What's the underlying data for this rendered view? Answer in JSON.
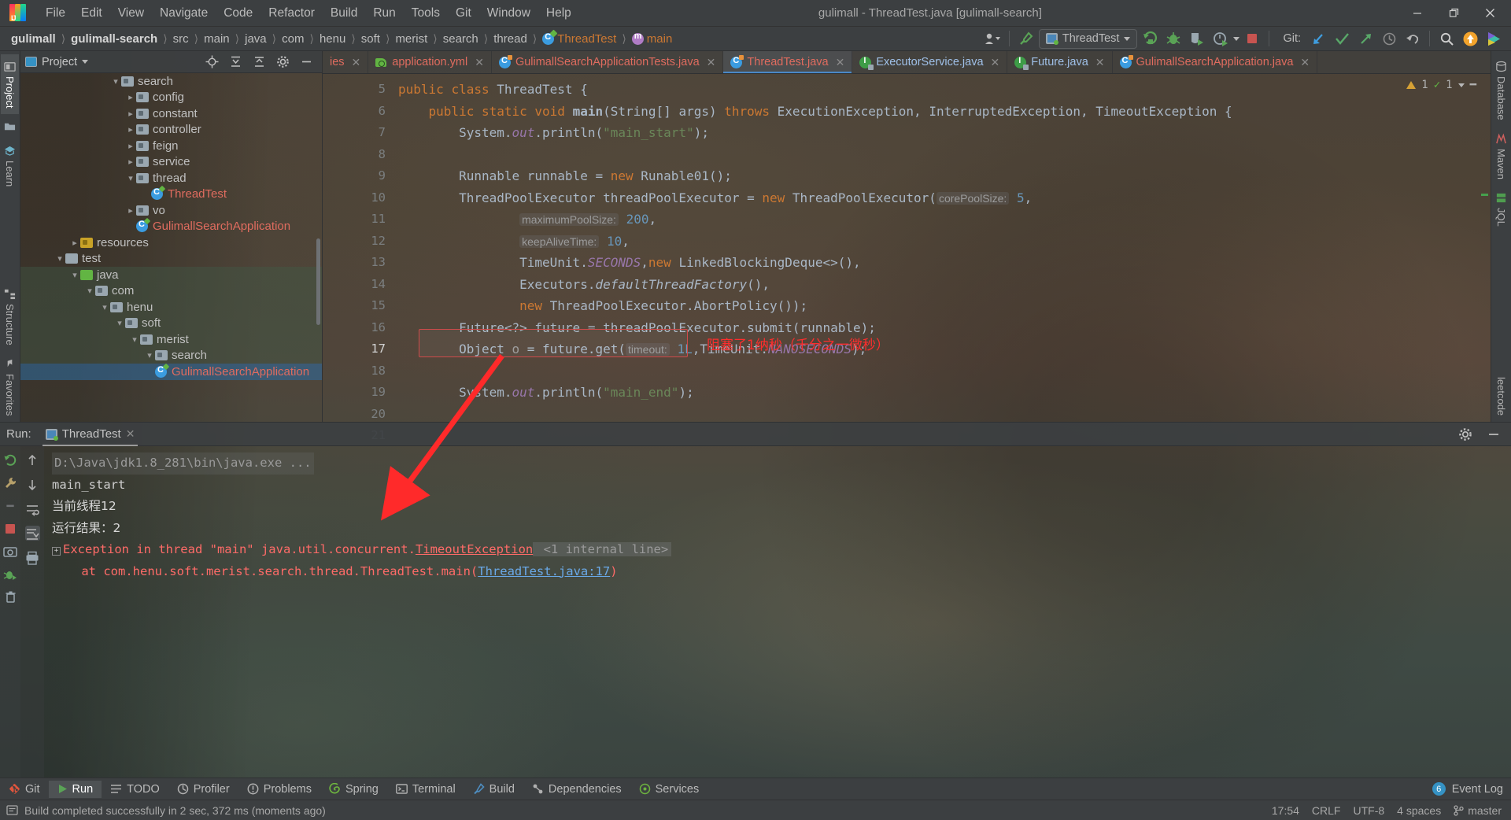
{
  "window": {
    "title": "gulimall - ThreadTest.java [gulimall-search]",
    "app_icon": "intellij-idea-logo",
    "minimize": "–",
    "maximize": "❐",
    "close": "✕"
  },
  "menu": [
    {
      "label": "File"
    },
    {
      "label": "Edit"
    },
    {
      "label": "View"
    },
    {
      "label": "Navigate"
    },
    {
      "label": "Code"
    },
    {
      "label": "Refactor"
    },
    {
      "label": "Build"
    },
    {
      "label": "Run"
    },
    {
      "label": "Tools"
    },
    {
      "label": "Git"
    },
    {
      "label": "Window"
    },
    {
      "label": "Help"
    }
  ],
  "breadcrumb": {
    "items": [
      {
        "label": "gulimall",
        "style": "bold"
      },
      {
        "label": "gulimall-search",
        "style": "bold"
      },
      {
        "label": "src",
        "style": "plain"
      },
      {
        "label": "main",
        "style": "plain"
      },
      {
        "label": "java",
        "style": "plain"
      },
      {
        "label": "com",
        "style": "plain"
      },
      {
        "label": "henu",
        "style": "plain"
      },
      {
        "label": "soft",
        "style": "plain"
      },
      {
        "label": "merist",
        "style": "plain"
      },
      {
        "label": "search",
        "style": "plain"
      },
      {
        "label": "thread",
        "style": "plain"
      },
      {
        "label": "ThreadTest",
        "style": "class"
      },
      {
        "label": "main",
        "style": "method"
      }
    ],
    "separator": "〉"
  },
  "toolbar": {
    "run_config_name": "ThreadTest",
    "git_label": "Git:",
    "buttons": [
      {
        "name": "user-account-icon"
      },
      {
        "name": "build-hammer-icon"
      },
      {
        "name": "run-icon"
      },
      {
        "name": "debug-icon"
      },
      {
        "name": "run-with-coverage-icon"
      },
      {
        "name": "profiler-icon"
      },
      {
        "name": "stop-icon"
      },
      {
        "name": "git-update-icon"
      },
      {
        "name": "git-commit-icon"
      },
      {
        "name": "git-push-icon"
      },
      {
        "name": "git-history-icon"
      },
      {
        "name": "git-rollback-icon"
      },
      {
        "name": "search-everywhere-icon"
      },
      {
        "name": "notification-icon"
      },
      {
        "name": "ide-feature-icon"
      }
    ]
  },
  "left_rail": [
    {
      "label": "Project",
      "icon": "project-icon",
      "active": true
    },
    {
      "label": "",
      "icon": "folder-icon",
      "active": false
    },
    {
      "label": "Learn",
      "icon": "learn-icon",
      "active": false
    },
    {
      "label": "Structure",
      "icon": "structure-icon",
      "active": false
    },
    {
      "label": "Favorites",
      "icon": "favorites-icon",
      "active": false
    }
  ],
  "right_rail": [
    {
      "label": "Database",
      "icon": "database-icon"
    },
    {
      "label": "Maven",
      "icon": "maven-icon"
    },
    {
      "label": "JQL",
      "icon": "jql-icon"
    },
    {
      "label": "leetcode",
      "icon": "leetcode-icon"
    }
  ],
  "project_panel": {
    "title": "Project",
    "actions": [
      {
        "name": "locate-icon"
      },
      {
        "name": "expand-all-icon"
      },
      {
        "name": "collapse-all-icon"
      },
      {
        "name": "settings-gear-icon"
      },
      {
        "name": "hide-panel-icon"
      }
    ],
    "tree": [
      {
        "label": "search",
        "indent": 6,
        "arrow": "down",
        "icon": "package",
        "selected": false
      },
      {
        "label": "config",
        "indent": 7,
        "arrow": "right",
        "icon": "package",
        "selected": false
      },
      {
        "label": "constant",
        "indent": 7,
        "arrow": "right",
        "icon": "package",
        "selected": false
      },
      {
        "label": "controller",
        "indent": 7,
        "arrow": "right",
        "icon": "package",
        "selected": false
      },
      {
        "label": "feign",
        "indent": 7,
        "arrow": "right",
        "icon": "package",
        "selected": false
      },
      {
        "label": "service",
        "indent": 7,
        "arrow": "right",
        "icon": "package",
        "selected": false
      },
      {
        "label": "thread",
        "indent": 7,
        "arrow": "down",
        "icon": "package",
        "selected": false
      },
      {
        "label": "ThreadTest",
        "indent": 8,
        "arrow": "none",
        "icon": "runnable-class",
        "selected": false
      },
      {
        "label": "vo",
        "indent": 7,
        "arrow": "right",
        "icon": "package",
        "selected": false
      },
      {
        "label": "GulimallSearchApplication",
        "indent": 7,
        "arrow": "none",
        "icon": "spring-class",
        "selected": false
      },
      {
        "label": "resources",
        "indent": 3,
        "arrow": "right",
        "icon": "resources",
        "selected": false
      },
      {
        "label": "test",
        "indent": 2,
        "arrow": "down",
        "icon": "folder",
        "selected": false
      },
      {
        "label": "java",
        "indent": 3,
        "arrow": "down",
        "icon": "source",
        "selected": false
      },
      {
        "label": "com",
        "indent": 4,
        "arrow": "down",
        "icon": "package",
        "selected": false
      },
      {
        "label": "henu",
        "indent": 5,
        "arrow": "down",
        "icon": "package",
        "selected": false
      },
      {
        "label": "soft",
        "indent": 6,
        "arrow": "down",
        "icon": "package",
        "selected": false
      },
      {
        "label": "merist",
        "indent": 7,
        "arrow": "down",
        "icon": "package",
        "selected": false
      },
      {
        "label": "search",
        "indent": 8,
        "arrow": "down",
        "icon": "package",
        "selected": false
      },
      {
        "label": "GulimallSearchApplication",
        "indent": 8,
        "arrow": "none",
        "icon": "spring-class",
        "selected": true
      }
    ]
  },
  "editor_tabs": [
    {
      "label": "ies",
      "icon": "truncated",
      "active": false,
      "closable": true
    },
    {
      "label": "application.yml",
      "icon": "yaml",
      "active": false,
      "closable": true
    },
    {
      "label": "GulimallSearchApplicationTests.java",
      "icon": "class",
      "active": false,
      "closable": true
    },
    {
      "label": "ThreadTest.java",
      "icon": "class",
      "active": true,
      "closable": true
    },
    {
      "label": "ExecutorService.java",
      "icon": "interface",
      "active": false,
      "closable": true
    },
    {
      "label": "Future.java",
      "icon": "interface",
      "active": false,
      "closable": true
    },
    {
      "label": "GulimallSearchApplication.java",
      "icon": "class",
      "active": false,
      "closable": true
    }
  ],
  "editor": {
    "file": "ThreadTest.java",
    "inspection": {
      "warnings": "1",
      "checks": "1"
    },
    "first_line_number": 5,
    "lines": [
      {
        "num": "5",
        "gutter_run": true,
        "fold": false,
        "text": "public class ThreadTest {"
      },
      {
        "num": "6",
        "gutter_run": true,
        "fold": true,
        "text": "    public static void main(String[] args) throws ExecutionException, InterruptedException, TimeoutException {"
      },
      {
        "num": "7",
        "gutter_run": false,
        "fold": false,
        "text": "        System.out.println(\"main_start\");"
      },
      {
        "num": "8",
        "gutter_run": false,
        "fold": false,
        "text": ""
      },
      {
        "num": "9",
        "gutter_run": false,
        "fold": false,
        "text": "        Runnable runnable = new Runable01();"
      },
      {
        "num": "10",
        "gutter_run": false,
        "fold": false,
        "text": "        ThreadPoolExecutor threadPoolExecutor = new ThreadPoolExecutor( corePoolSize: 5,"
      },
      {
        "num": "11",
        "gutter_run": false,
        "fold": false,
        "text": "                maximumPoolSize: 200,"
      },
      {
        "num": "12",
        "gutter_run": false,
        "fold": false,
        "text": "                keepAliveTime: 10,"
      },
      {
        "num": "13",
        "gutter_run": false,
        "fold": false,
        "text": "                TimeUnit.SECONDS,new LinkedBlockingDeque<>(),"
      },
      {
        "num": "14",
        "gutter_run": false,
        "fold": false,
        "text": "                Executors.defaultThreadFactory(),"
      },
      {
        "num": "15",
        "gutter_run": false,
        "fold": false,
        "text": "                new ThreadPoolExecutor.AbortPolicy());"
      },
      {
        "num": "16",
        "gutter_run": false,
        "fold": false,
        "text": "        Future<?> future = threadPoolExecutor.submit(runnable);"
      },
      {
        "num": "17",
        "gutter_run": false,
        "fold": false,
        "text": "        Object o = future.get( timeout: 1L,TimeUnit.NANOSECONDS);"
      },
      {
        "num": "18",
        "gutter_run": false,
        "fold": false,
        "text": ""
      },
      {
        "num": "19",
        "gutter_run": false,
        "fold": false,
        "text": "        System.out.println(\"main_end\");"
      },
      {
        "num": "20",
        "gutter_run": false,
        "fold": false,
        "text": ""
      },
      {
        "num": "21",
        "gutter_run": false,
        "fold": true,
        "text": "    }"
      }
    ],
    "annotation": {
      "text": "阻塞了1纳秒（千分之一微秒）",
      "color": "#ff2d2d",
      "highlight_line": "17",
      "highlight_color": "#cf4a4a"
    }
  },
  "run_window": {
    "label": "Run:",
    "tab_name": "ThreadTest",
    "close_icon": "✕",
    "settings_icon": "gear-icon",
    "minimize_icon": "minimize-icon",
    "side_buttons": [
      {
        "name": "rerun-icon"
      },
      {
        "name": "rerun-failed-icon"
      },
      {
        "name": "stop-icon"
      },
      {
        "name": "screenshot-icon"
      },
      {
        "name": "debug-icon"
      },
      {
        "name": "trash-icon"
      }
    ],
    "side_buttons2": [
      {
        "name": "scroll-up-icon"
      },
      {
        "name": "scroll-down-icon"
      },
      {
        "name": "soft-wrap-icon"
      },
      {
        "name": "scroll-to-end-icon"
      },
      {
        "name": "print-icon"
      }
    ],
    "console": [
      {
        "type": "cmd",
        "text": "D:\\Java\\jdk1.8_281\\bin\\java.exe ..."
      },
      {
        "type": "out",
        "text": "main_start"
      },
      {
        "type": "out",
        "text": "当前线程12"
      },
      {
        "type": "out",
        "text": "运行结果：2"
      },
      {
        "type": "exception",
        "prefix": "Exception in thread \"main\" java.util.concurrent.",
        "link": "TimeoutException",
        "suffix": " <1 internal line>"
      },
      {
        "type": "stack",
        "prefix": "    at com.henu.soft.merist.search.thread.ThreadTest.main(",
        "link": "ThreadTest.java:17",
        "suffix": ")"
      }
    ]
  },
  "bottom_bar": {
    "items": [
      {
        "label": "Git",
        "icon": "git-icon",
        "active": false
      },
      {
        "label": "Run",
        "icon": "run-icon",
        "active": true
      },
      {
        "label": "TODO",
        "icon": "todo-icon",
        "active": false
      },
      {
        "label": "Profiler",
        "icon": "profiler-icon",
        "active": false
      },
      {
        "label": "Problems",
        "icon": "problems-icon",
        "active": false
      },
      {
        "label": "Spring",
        "icon": "spring-icon",
        "active": false
      },
      {
        "label": "Terminal",
        "icon": "terminal-icon",
        "active": false
      },
      {
        "label": "Build",
        "icon": "build-icon",
        "active": false
      },
      {
        "label": "Dependencies",
        "icon": "dependencies-icon",
        "active": false
      },
      {
        "label": "Services",
        "icon": "services-icon",
        "active": false
      }
    ],
    "event_log": {
      "label": "Event Log",
      "count": "6"
    }
  },
  "status_bar": {
    "message": "Build completed successfully in 2 sec, 372 ms (moments ago)",
    "time": "17:54",
    "line_separator": "CRLF",
    "encoding": "UTF-8",
    "indent": "4 spaces",
    "branch": "master",
    "branch_icon": "git-branch-icon",
    "message_icon": "info-icon"
  },
  "colors": {
    "accent_blue": "#3592c4",
    "green": "#62b543",
    "red": "#ff2d2d",
    "error_red": "#ff6b68",
    "keyword_orange": "#cc7832",
    "string_green": "#6a8759",
    "number_blue": "#6897bb",
    "panel_bg": "#3c3f41"
  }
}
